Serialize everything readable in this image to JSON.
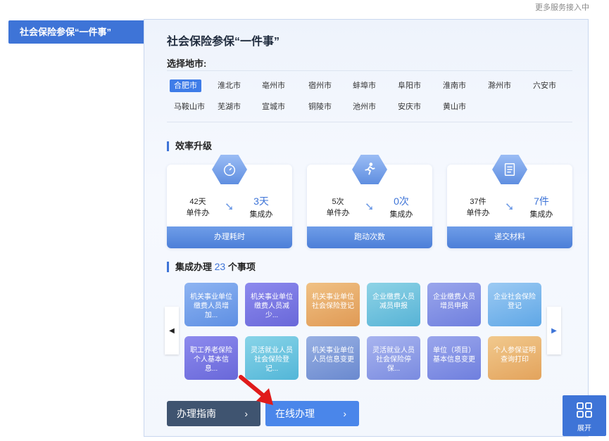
{
  "top_note": "更多服务接入中",
  "side_tab": {
    "label": "社会保险参保“一件事”"
  },
  "panel": {
    "title": "社会保险参保“一件事”",
    "city_label": "选择地市:",
    "cities": [
      "合肥市",
      "淮北市",
      "亳州市",
      "宿州市",
      "蚌埠市",
      "阜阳市",
      "淮南市",
      "滁州市",
      "六安市",
      "马鞍山市",
      "芜湖市",
      "宣城市",
      "铜陵市",
      "池州市",
      "安庆市",
      "黄山市"
    ],
    "selected_city": "合肥市"
  },
  "efficiency": {
    "title": "效率升级",
    "cards": [
      {
        "icon": "stopwatch-icon",
        "before_value": "42天",
        "before_label": "单件办",
        "after_value": "3天",
        "after_label": "集成办",
        "footer": "办理耗时"
      },
      {
        "icon": "running-person-icon",
        "before_value": "5次",
        "before_label": "单件办",
        "after_value": "0次",
        "after_label": "集成办",
        "footer": "跑动次数"
      },
      {
        "icon": "document-icon",
        "before_value": "37件",
        "before_label": "单件办",
        "after_value": "7件",
        "after_label": "集成办",
        "footer": "递交材料"
      }
    ]
  },
  "integrated": {
    "title_prefix": "集成办理",
    "count": "23",
    "title_suffix": "个事项",
    "items": [
      {
        "label": "机关事业单位缴费人员增加...",
        "color": "c-blue"
      },
      {
        "label": "机关事业单位缴费人员减少...",
        "color": "c-purple"
      },
      {
        "label": "机关事业单位社会保险登记",
        "color": "c-orange"
      },
      {
        "label": "企业缴费人员减员申报",
        "color": "c-teal"
      },
      {
        "label": "企业缴费人员增员申报",
        "color": "c-indigo"
      },
      {
        "label": "企业社会保险登记",
        "color": "c-sky"
      },
      {
        "label": "职工养老保险个人基本信息...",
        "color": "c-purple"
      },
      {
        "label": "灵活就业人员社会保险登记...",
        "color": "c-cyan"
      },
      {
        "label": "机关事业单位人员信息变更",
        "color": "c-steel"
      },
      {
        "label": "灵活就业人员社会保险停保...",
        "color": "c-lav"
      },
      {
        "label": "单位（项目）基本信息变更",
        "color": "c-indigo"
      },
      {
        "label": "个人参保证明查询打印",
        "color": "c-gold"
      }
    ]
  },
  "buttons": {
    "guide": "办理指南",
    "online": "在线办理",
    "chevron": "›"
  },
  "expand": {
    "label": "展开"
  },
  "colors": {
    "accent": "#3e74d7",
    "dark": "#3f5470"
  }
}
